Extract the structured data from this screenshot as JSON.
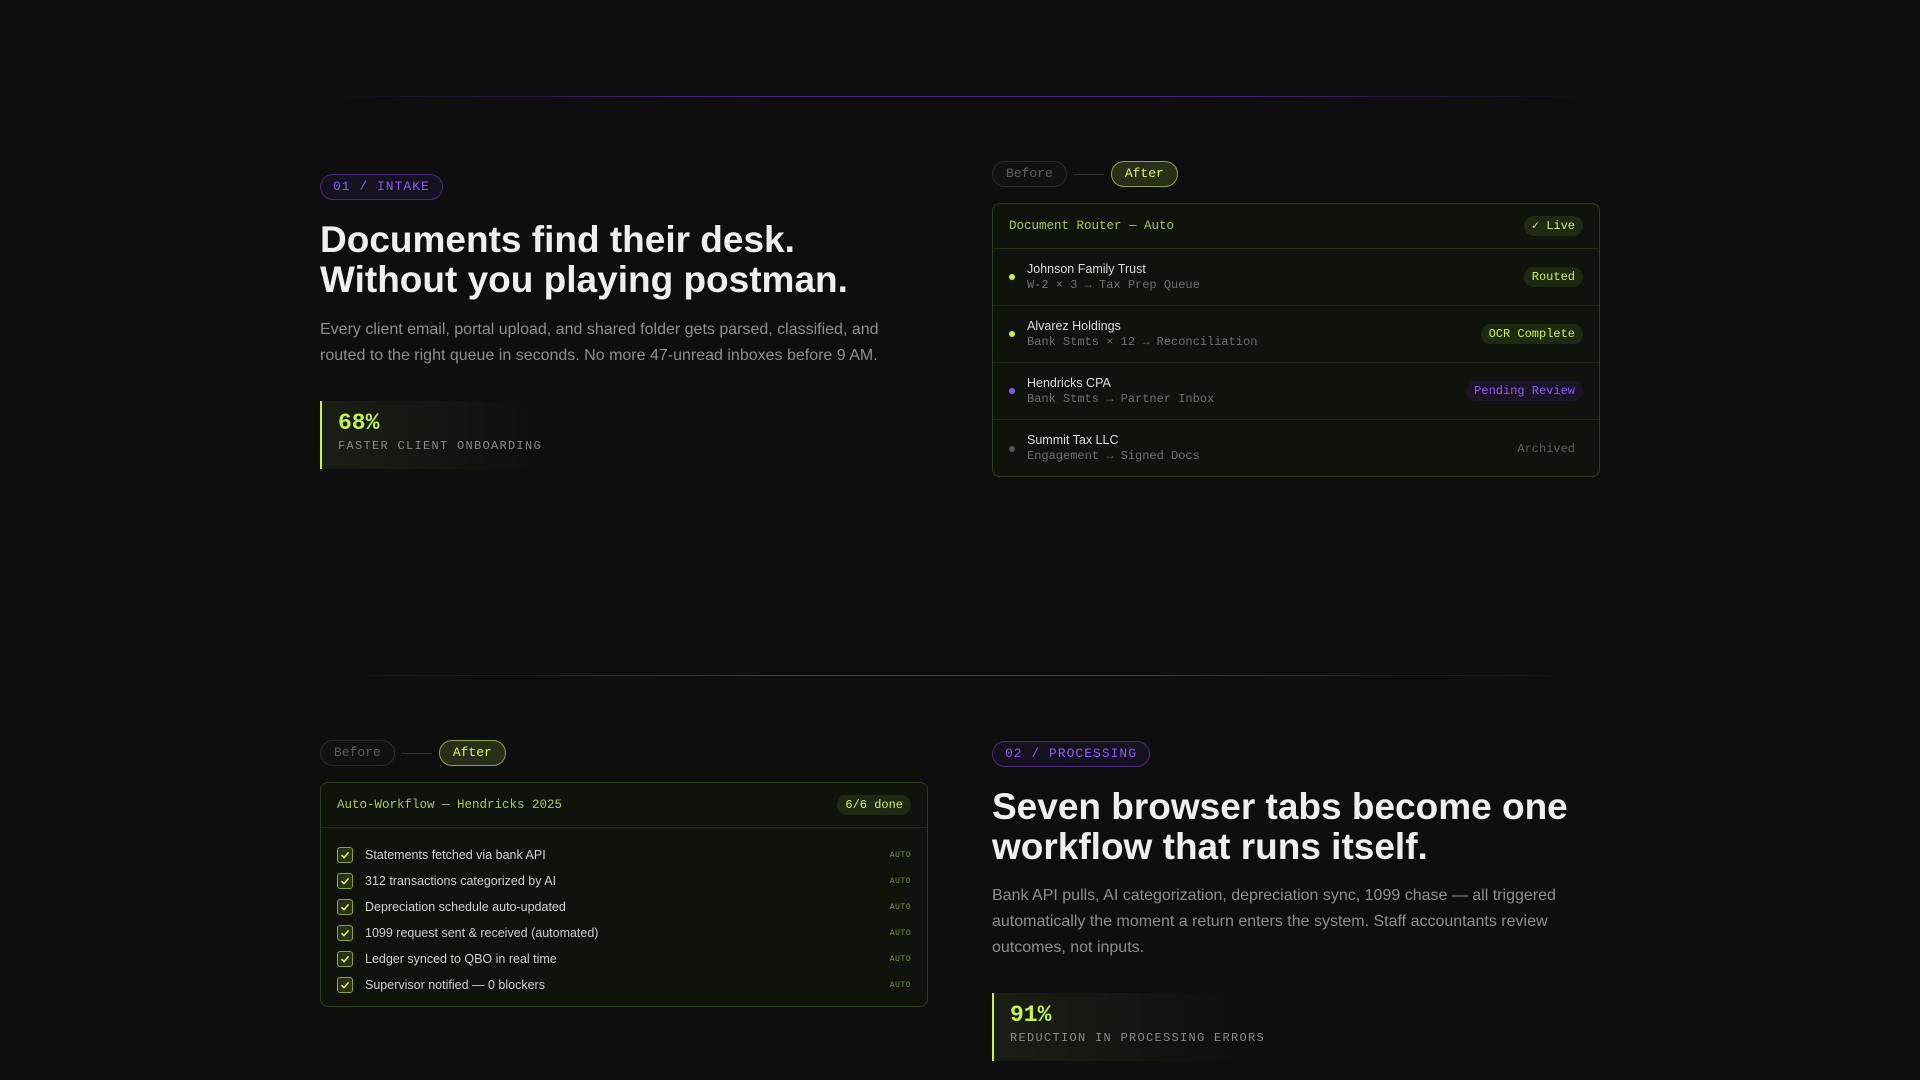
{
  "colors": {
    "accent": "#c6f24e",
    "purple": "#8b5cf6",
    "background": "#0e0e0e"
  },
  "intake": {
    "tag": "01 / INTAKE",
    "headline": "Documents find their desk. Without you playing postman.",
    "body": "Every client email, portal upload, and shared folder gets parsed, classified, and routed to the right queue in seconds. No more 47-unread inboxes before 9 AM.",
    "stat_value": "68%",
    "stat_label": "FASTER CLIENT ONBOARDING",
    "toggle": {
      "before": "Before",
      "after": "After"
    },
    "panel": {
      "title": "Document Router — Auto",
      "badge": "✓ Live",
      "rows": [
        {
          "name": "Johnson Family Trust",
          "meta": "W-2 × 3 → Tax Prep Queue",
          "status": "Routed",
          "dot": "#c6f24e"
        },
        {
          "name": "Alvarez Holdings",
          "meta": "Bank Stmts × 12 → Reconciliation",
          "status": "OCR Complete",
          "dot": "#c6f24e"
        },
        {
          "name": "Hendricks CPA",
          "meta": "Bank Stmts → Partner Inbox",
          "status": "Pending Review",
          "dot": "#8b5cf6"
        },
        {
          "name": "Summit Tax LLC",
          "meta": "Engagement → Signed Docs",
          "status": "Archived",
          "dot": "#555555"
        }
      ]
    }
  },
  "processing": {
    "tag": "02 / PROCESSING",
    "headline": "Seven browser tabs become one workflow that runs itself.",
    "body": "Bank API pulls, AI categorization, depreciation sync, 1099 chase — all triggered automatically the moment a return enters the system. Staff accountants review outcomes, not inputs.",
    "stat_value": "91%",
    "stat_label": "REDUCTION IN PROCESSING ERRORS",
    "toggle": {
      "before": "Before",
      "after": "After"
    },
    "panel": {
      "title": "Auto-Workflow — Hendricks 2025",
      "badge": "6/6 done",
      "items": [
        {
          "label": "Statements fetched via bank API",
          "tag": "AUTO"
        },
        {
          "label": "312 transactions categorized by AI",
          "tag": "AUTO"
        },
        {
          "label": "Depreciation schedule auto-updated",
          "tag": "AUTO"
        },
        {
          "label": "1099 request sent & received (automated)",
          "tag": "AUTO"
        },
        {
          "label": "Ledger synced to QBO in real time",
          "tag": "AUTO"
        },
        {
          "label": "Supervisor notified — 0 blockers",
          "tag": "AUTO"
        }
      ]
    }
  }
}
